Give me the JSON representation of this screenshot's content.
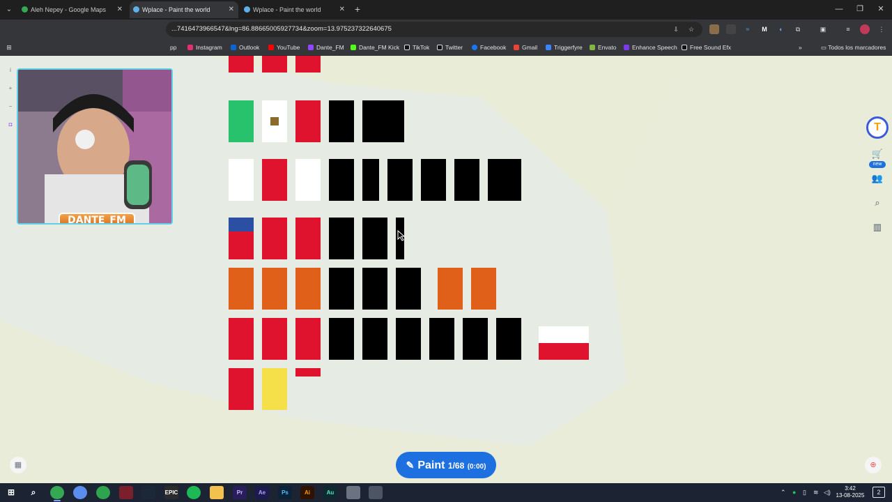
{
  "tabs": [
    {
      "title": "Aleh Nepey - Google Maps",
      "active": false
    },
    {
      "title": "Wplace - Paint the world",
      "active": true
    },
    {
      "title": "Wplace - Paint the world",
      "active": false
    }
  ],
  "window_controls": {
    "minimize": "—",
    "restore": "❐",
    "close": "✕"
  },
  "address_bar": {
    "url": "...7416473966547&lng=86.88665005927734&zoom=13.975237322640675"
  },
  "bookmarks": [
    {
      "label": "Instagram",
      "color": "#e1306c"
    },
    {
      "label": "Outlook",
      "color": "#0a64d6"
    },
    {
      "label": "YouTube",
      "color": "#ff0000"
    },
    {
      "label": "Dante_FM",
      "color": "#9146ff"
    },
    {
      "label": "Dante_FM Kick",
      "color": "#53fc18"
    },
    {
      "label": "TikTok",
      "color": "#111111"
    },
    {
      "label": "Twitter",
      "color": "#111111"
    },
    {
      "label": "Facebook",
      "color": "#1877f2"
    },
    {
      "label": "Gmail",
      "color": "#ea4335"
    },
    {
      "label": "Triggerfyre",
      "color": "#3a86ff"
    },
    {
      "label": "Envato",
      "color": "#82b541"
    },
    {
      "label": "Enhance Speech",
      "color": "#7c3aed"
    },
    {
      "label": "Free Sound Efx",
      "color": "#111111"
    }
  ],
  "bookmarks_app_partial": "pp",
  "bookmarks_right": "Todos los marcadores",
  "webcam": {
    "name": "DANTE_FM"
  },
  "paint_button": {
    "label": "Paint",
    "count": "1/68",
    "timer": "(0:00)"
  },
  "side_badge_new": "new",
  "logo_letter": "T",
  "taskbar": {
    "time": "3:42",
    "date": "13-08-2025",
    "notif_count": "2"
  },
  "colors": {
    "red": "#e0132f",
    "green": "#27c26b",
    "black": "#000000",
    "white": "#ffffff",
    "orange": "#e0601a",
    "yellow": "#f6e04a",
    "blue": "#2b4fa3",
    "brown": "#8b6a2e",
    "accent": "#1e6fe0"
  }
}
